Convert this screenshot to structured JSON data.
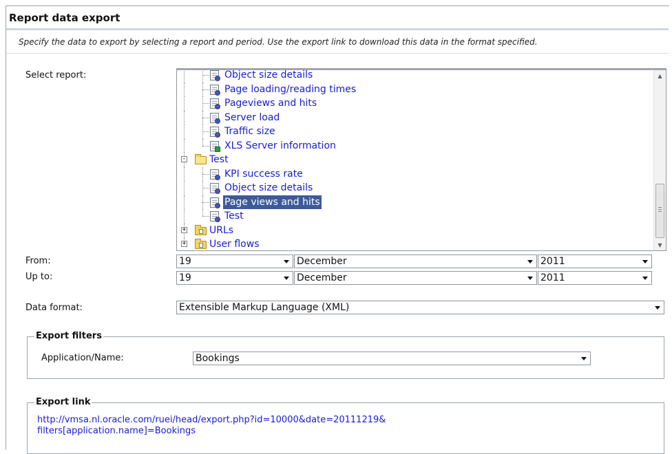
{
  "header": {
    "title": "Report data export",
    "subtitle": "Specify the data to export by selecting a report and period. Use the export link to download this data in the format specified."
  },
  "form": {
    "select_report_label": "Select report:",
    "from_label": "From:",
    "upto_label": "Up to:",
    "data_format_label": "Data format:"
  },
  "tree": {
    "items": [
      {
        "label": "Object size details",
        "type": "report",
        "level": 2
      },
      {
        "label": "Page loading/reading times",
        "type": "report",
        "level": 2
      },
      {
        "label": "Pageviews and hits",
        "type": "report",
        "level": 2
      },
      {
        "label": "Server load",
        "type": "report",
        "level": 2
      },
      {
        "label": "Traffic size",
        "type": "report",
        "level": 2
      },
      {
        "label": "XLS Server information",
        "type": "xls",
        "level": 2
      },
      {
        "label": "Test",
        "type": "folder-open",
        "level": 1,
        "expander": "-"
      },
      {
        "label": "KPI success rate",
        "type": "report",
        "level": 2
      },
      {
        "label": "Object size details",
        "type": "report",
        "level": 2
      },
      {
        "label": "Page views and hits",
        "type": "report",
        "level": 2,
        "selected": true
      },
      {
        "label": "Test",
        "type": "report",
        "level": 2
      },
      {
        "label": "URLs",
        "type": "folder",
        "level": 1,
        "expander": "+"
      },
      {
        "label": "User flows",
        "type": "folder",
        "level": 1,
        "expander": "+"
      }
    ]
  },
  "from": {
    "day": "19",
    "month": "December",
    "year": "2011"
  },
  "upto": {
    "day": "19",
    "month": "December",
    "year": "2011"
  },
  "data_format": {
    "value": "Extensible Markup Language (XML)"
  },
  "filters": {
    "legend": "Export filters",
    "application_label": "Application/Name:",
    "application_value": "Bookings"
  },
  "export": {
    "legend": "Export link",
    "link_line1": "http://vmsa.nl.oracle.com/ruei/head/export.php?id=10000&date=20111219&",
    "link_line2": "filters[application.name]=Bookings"
  },
  "colors": {
    "link": "#1a1ad6",
    "selected_bg": "#3d5a98"
  }
}
